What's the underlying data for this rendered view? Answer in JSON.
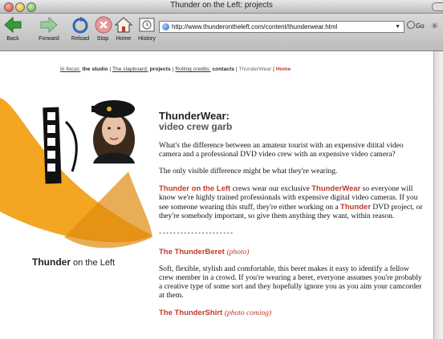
{
  "window": {
    "title": "Thunder on the Left: projects"
  },
  "toolbar": {
    "buttons": [
      {
        "label": "Back"
      },
      {
        "label": "Forward"
      },
      {
        "label": "Reload"
      },
      {
        "label": "Stop"
      },
      {
        "label": "Home"
      },
      {
        "label": "History"
      }
    ],
    "url": "http://www.thunderontheleft.com/content/thunderwear.html",
    "go_label": "Go"
  },
  "nav": {
    "in_focus_label": "In focus:",
    "studio": "the studio",
    "clapboard_label": "The clapboard:",
    "projects": "projects",
    "rolling_label": "Rolling credits:",
    "contacts": "contacts",
    "thunderwear": "ThunderWear",
    "home": "Home",
    "sep": "|"
  },
  "logo": {
    "brand": "Thunder",
    "rest": " on the Left"
  },
  "article": {
    "title": "ThunderWear:",
    "subtitle": "video crew garb",
    "p1": "What's the difference between an amateur tourist with an expensive ditital video camera and a professional DVD video crew with an expensive video camera?",
    "p2": "The only visible difference might be what they're wearing.",
    "p3_brand": "Thunder on the Left",
    "p3_a": " crews wear our exclusive ",
    "p3_tw": "ThunderWear",
    "p3_b": " so everyone will know we're highly trained professionals with expensive digital video cameras. If you see someone wearing this stuff, they're either working on a ",
    "p3_thunder": "Thunder",
    "p3_c": " DVD project, or they're somebody important, so give them anything they want, within reason.",
    "dots": "•••••••••••••••••••••",
    "beret_title": "The ThunderBeret",
    "beret_note": "(photo)",
    "beret_text": "Soft, flexible, stylish and comfortable, this beret makes it easy to identify a fellow crew member in a crowd. If you're wearing a beret, everyone assumes you're probably a creative type of some sort and they hopefully ignore you as you aim your camcorder at them.",
    "shirt_title": "The ThunderShirt",
    "shirt_note": "(photo coming)"
  }
}
